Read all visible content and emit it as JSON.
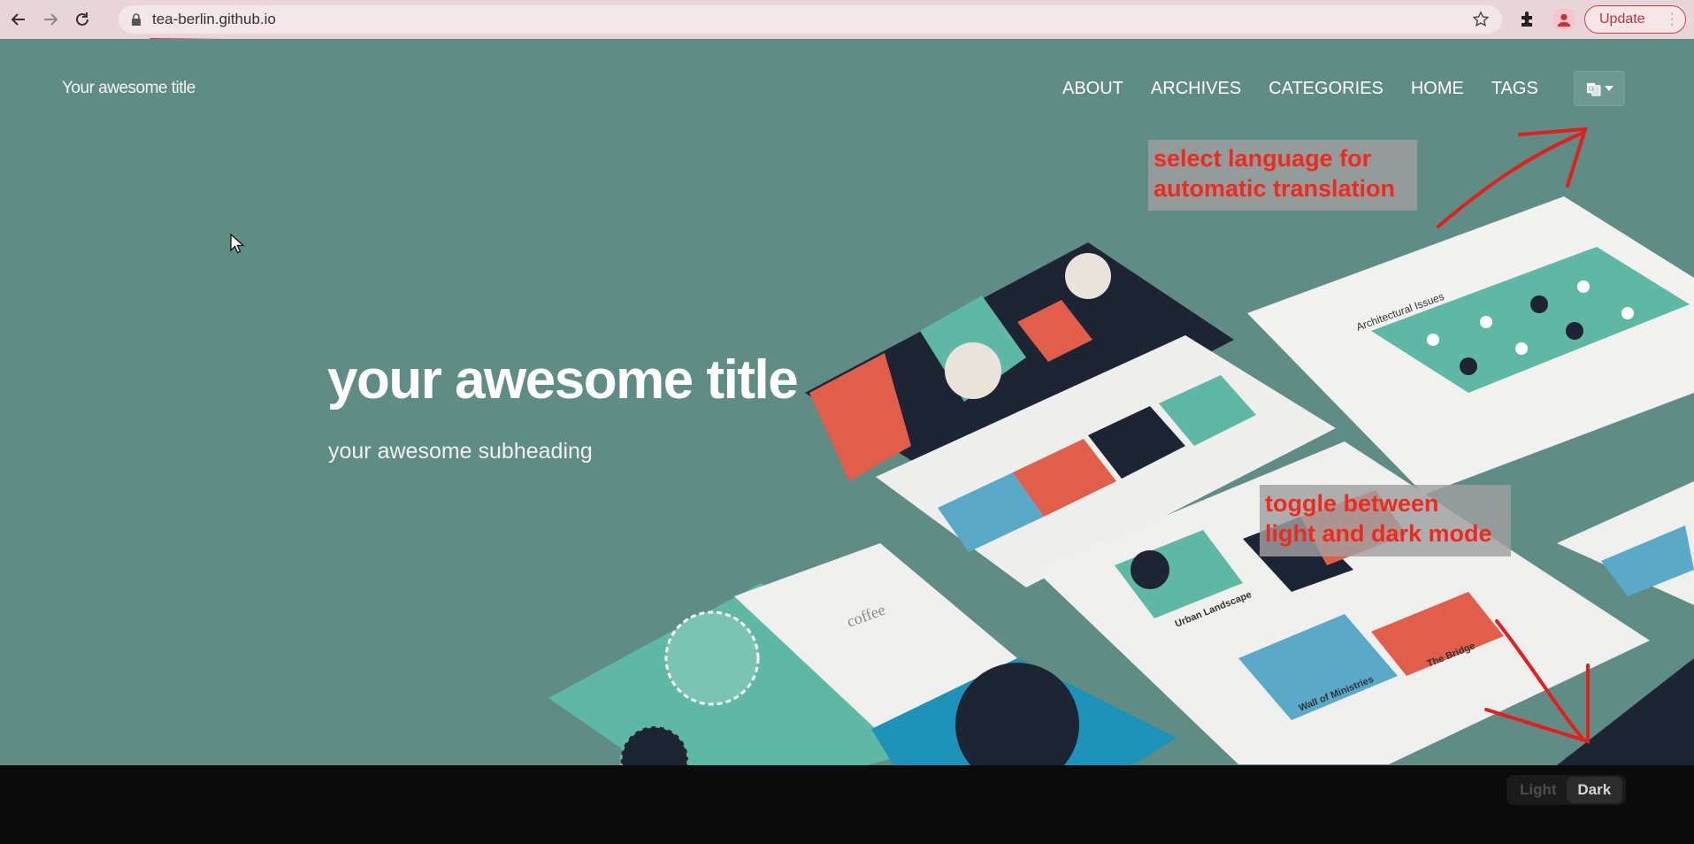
{
  "browser": {
    "url": "tea-berlin.github.io",
    "update_label": "Update"
  },
  "site": {
    "title": "Your awesome title",
    "nav": [
      "ABOUT",
      "ARCHIVES",
      "CATEGORIES",
      "HOME",
      "TAGS"
    ],
    "language_selector": "translate-icon"
  },
  "hero": {
    "heading": "your awesome title",
    "subheading": "your awesome subheading",
    "mockup_labels": {
      "coffee": "coffee",
      "architectural": "Architectural Issues",
      "urban": "Urban Landscape",
      "wall": "Wall of Ministries",
      "bridge": "The Bridge"
    }
  },
  "annotations": {
    "language": [
      "select language for",
      "automatic translation"
    ],
    "theme": [
      "toggle between",
      "light and dark mode"
    ]
  },
  "theme_toggle": {
    "light": "Light",
    "dark": "Dark"
  },
  "colors": {
    "hero_bg": "#5f8c84",
    "annotation_red": "#ee2a1f",
    "chrome_bg": "#e9d4d7"
  }
}
